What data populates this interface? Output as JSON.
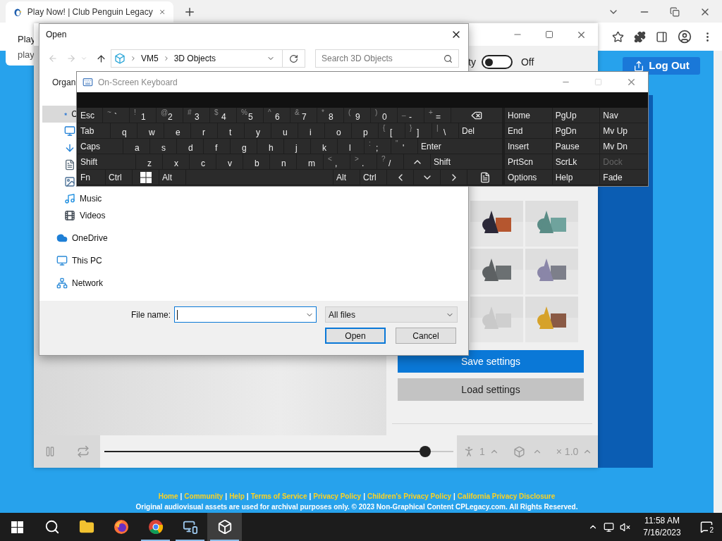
{
  "browser": {
    "tab": {
      "title": "Play Now! | Club Penguin Legacy"
    },
    "notification": {
      "title": "Play",
      "text": "play"
    }
  },
  "page": {
    "log_out": "Log Out",
    "separator": "|",
    "footer_links": [
      "Home",
      "Community",
      "Help",
      "Terms of Service",
      "Privacy Policy",
      "Children's Privacy Policy",
      "California Privacy Disclosure"
    ],
    "copyright": "Original audiovisual assets are used for archival purposes only. © 2023 Non-Graphical Content CPLegacy.com. All Rights Reserved."
  },
  "viewer": {
    "toggle": {
      "label": "ty",
      "on": false,
      "state_text": "Off"
    },
    "save_button": "Save settings",
    "load_button": "Load settings",
    "playback": {
      "level": 0.92,
      "count": "1",
      "speed": "× 1.0"
    }
  },
  "open_dialog": {
    "title": "Open",
    "breadcrumb": [
      "VM5",
      "3D Objects"
    ],
    "search_placeholder": "Search 3D Objects",
    "toolbar_text": "Organ",
    "nav_items": [
      {
        "kind": "star",
        "label": "C",
        "selected": true
      },
      {
        "kind": "desktop",
        "selected": false
      },
      {
        "kind": "download",
        "selected": false
      },
      {
        "kind": "document",
        "selected": false
      },
      {
        "kind": "pictures",
        "selected": false
      },
      {
        "kind": "music",
        "label": "Music",
        "selected": false
      },
      {
        "kind": "video",
        "label": "Videos",
        "selected": false
      },
      {
        "kind": "cloud",
        "label": "OneDrive",
        "selected": false
      },
      {
        "kind": "pc",
        "label": "This PC",
        "selected": false
      },
      {
        "kind": "network",
        "label": "Network",
        "selected": false
      }
    ],
    "file_name_label": "File name:",
    "filter": "All files",
    "open_button": "Open",
    "cancel_button": "Cancel"
  },
  "keyboard": {
    "title": "On-Screen Keyboard",
    "rows": [
      [
        {
          "kind": "lead",
          "label": "Esc"
        },
        {
          "kind": "char",
          "shift": "~",
          "label": "`"
        },
        {
          "kind": "char",
          "shift": "!",
          "label": "1"
        },
        {
          "kind": "char",
          "shift": "@",
          "label": "2"
        },
        {
          "kind": "char",
          "shift": "#",
          "label": "3"
        },
        {
          "kind": "char",
          "shift": "$",
          "label": "4"
        },
        {
          "kind": "char",
          "shift": "%",
          "label": "5"
        },
        {
          "kind": "char",
          "shift": "^",
          "label": "6"
        },
        {
          "kind": "char",
          "shift": "&",
          "label": "7"
        },
        {
          "kind": "char",
          "shift": "*",
          "label": "8"
        },
        {
          "kind": "char",
          "shift": "(",
          "label": "9"
        },
        {
          "kind": "char",
          "shift": ")",
          "label": "0"
        },
        {
          "kind": "char",
          "shift": "_",
          "label": "-"
        },
        {
          "kind": "char",
          "shift": "+",
          "label": "="
        },
        {
          "kind": "backspace"
        }
      ],
      [
        {
          "kind": "lead",
          "label": "Tab"
        },
        {
          "kind": "char",
          "label": "q"
        },
        {
          "kind": "char",
          "label": "w"
        },
        {
          "kind": "char",
          "label": "e"
        },
        {
          "kind": "char",
          "label": "r"
        },
        {
          "kind": "char",
          "label": "t"
        },
        {
          "kind": "char",
          "label": "y"
        },
        {
          "kind": "char",
          "label": "u"
        },
        {
          "kind": "char",
          "label": "i"
        },
        {
          "kind": "char",
          "label": "o"
        },
        {
          "kind": "char",
          "label": "p"
        },
        {
          "kind": "char",
          "shift": "{",
          "label": "["
        },
        {
          "kind": "char",
          "shift": "}",
          "label": "]"
        },
        {
          "kind": "char",
          "shift": "|",
          "label": "\\"
        },
        {
          "kind": "wide",
          "label": "Del"
        }
      ],
      [
        {
          "kind": "lead",
          "label": "Caps"
        },
        {
          "kind": "char",
          "label": "a"
        },
        {
          "kind": "char",
          "label": "s"
        },
        {
          "kind": "char",
          "label": "d"
        },
        {
          "kind": "char",
          "label": "f"
        },
        {
          "kind": "char",
          "label": "g"
        },
        {
          "kind": "char",
          "label": "h"
        },
        {
          "kind": "char",
          "label": "j"
        },
        {
          "kind": "char",
          "label": "k"
        },
        {
          "kind": "char",
          "label": "l"
        },
        {
          "kind": "char",
          "shift": ":",
          "label": ";"
        },
        {
          "kind": "char",
          "shift": "\"",
          "label": "'"
        },
        {
          "kind": "wide",
          "label": "Enter"
        }
      ],
      [
        {
          "kind": "lead",
          "label": "Shift"
        },
        {
          "kind": "char",
          "label": "z"
        },
        {
          "kind": "char",
          "label": "x"
        },
        {
          "kind": "char",
          "label": "c"
        },
        {
          "kind": "char",
          "label": "v"
        },
        {
          "kind": "char",
          "label": "b"
        },
        {
          "kind": "char",
          "label": "n"
        },
        {
          "kind": "char",
          "label": "m"
        },
        {
          "kind": "char",
          "shift": "<",
          "label": ","
        },
        {
          "kind": "char",
          "shift": ">",
          "label": "."
        },
        {
          "kind": "char",
          "shift": "?",
          "label": "/"
        },
        {
          "kind": "up"
        },
        {
          "kind": "wide",
          "label": "Shift"
        }
      ],
      [
        {
          "kind": "lead",
          "label": "Fn"
        },
        {
          "kind": "char",
          "label": "Ctrl"
        },
        {
          "kind": "windows"
        },
        {
          "kind": "char",
          "label": "Alt"
        },
        {
          "kind": "wide"
        },
        {
          "kind": "char",
          "label": "Alt"
        },
        {
          "kind": "char",
          "label": "Ctrl"
        },
        {
          "kind": "left"
        },
        {
          "kind": "down"
        },
        {
          "kind": "right"
        },
        {
          "kind": "menu"
        }
      ]
    ],
    "nav_rows": [
      [
        {
          "label": "Home",
          "disabled": false
        },
        {
          "label": "PgUp",
          "disabled": false
        },
        {
          "label": "Nav",
          "disabled": false
        }
      ],
      [
        {
          "label": "End",
          "disabled": false
        },
        {
          "label": "PgDn",
          "disabled": false
        },
        {
          "label": "Mv Up",
          "disabled": false
        }
      ],
      [
        {
          "label": "Insert",
          "disabled": false
        },
        {
          "label": "Pause",
          "disabled": false
        },
        {
          "label": "Mv Dn",
          "disabled": false
        }
      ],
      [
        {
          "label": "PrtScn",
          "disabled": false
        },
        {
          "label": "ScrLk",
          "disabled": false
        },
        {
          "label": "Dock",
          "disabled": true
        }
      ],
      [
        {
          "label": "Options",
          "disabled": false
        },
        {
          "label": "Help",
          "disabled": false
        },
        {
          "label": "Fade",
          "disabled": false
        }
      ]
    ]
  },
  "taskbar": {
    "apps": [
      {
        "kind": "start",
        "running": false,
        "selected": false
      },
      {
        "kind": "search",
        "running": false,
        "selected": false
      },
      {
        "kind": "explorer",
        "running": false,
        "selected": false
      },
      {
        "kind": "firefox",
        "running": false,
        "selected": false
      },
      {
        "kind": "chrome",
        "running": true,
        "selected": false
      },
      {
        "kind": "remote",
        "running": true,
        "selected": false
      },
      {
        "kind": "viewer",
        "running": true,
        "selected": true
      }
    ],
    "time": "11:58 AM",
    "date": "7/16/2023",
    "notifications": "2"
  }
}
